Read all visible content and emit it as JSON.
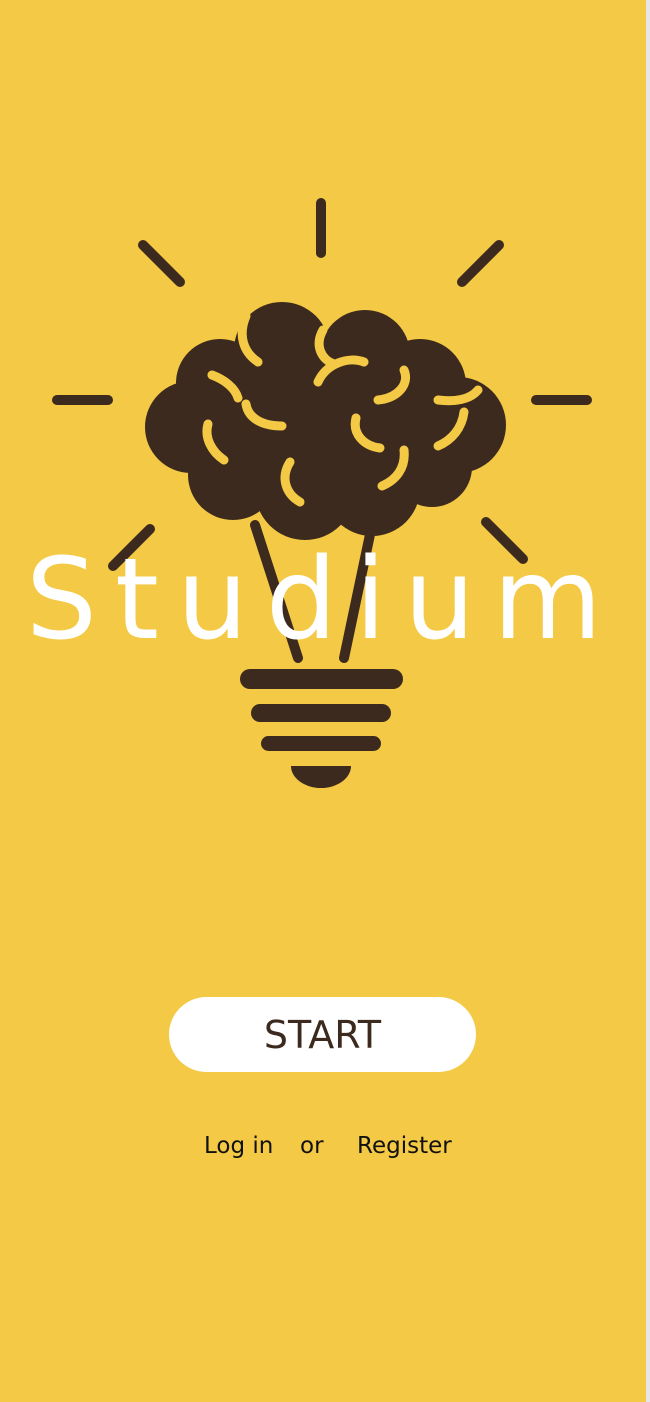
{
  "app": {
    "title": "Studium"
  },
  "actions": {
    "start_label": "START",
    "login_label": "Log in",
    "separator": "or",
    "register_label": "Register"
  },
  "icons": {
    "logo": "lightbulb-brain-icon"
  },
  "colors": {
    "background": "#f4c945",
    "primary_dark": "#3d2a1e",
    "button_bg": "#ffffff",
    "title_text": "#ffffff"
  }
}
